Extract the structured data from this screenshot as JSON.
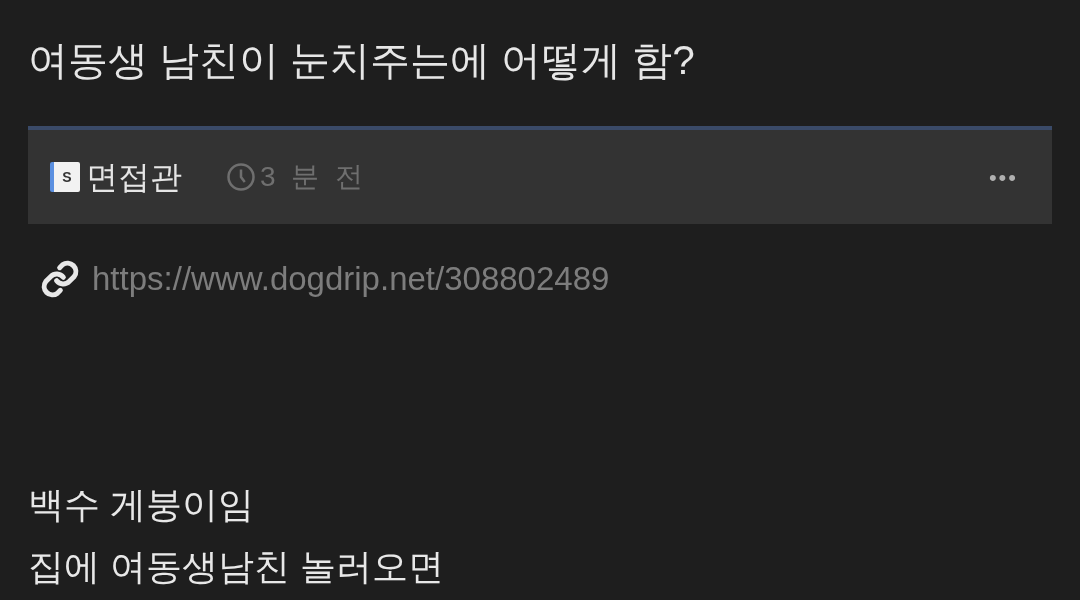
{
  "post": {
    "title": "여동생 남친이 눈치주는에 어떻게 함?",
    "author": {
      "badge": "S",
      "name": "면접관"
    },
    "time": "3 분 전",
    "more": "•••",
    "url": "https://www.dogdrip.net/308802489",
    "body": [
      "백수 게붕이임",
      "집에 여동생남친 놀러오면"
    ]
  }
}
